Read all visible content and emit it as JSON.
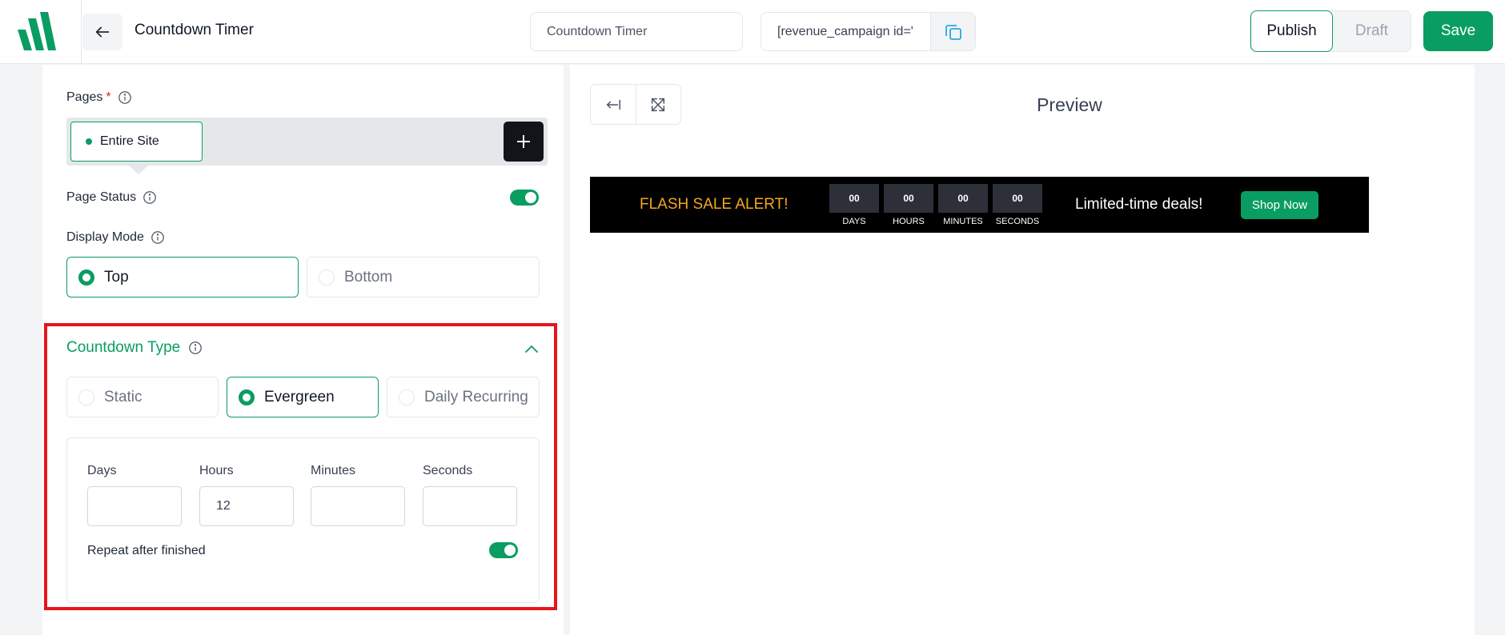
{
  "colors": {
    "brand_green": "#0a9d61",
    "highlight_red": "#e8141b",
    "banner_headline": "#f5a623"
  },
  "header": {
    "page_title": "Countdown Timer",
    "title_input_value": "Countdown Timer",
    "shortcode_value": "[revenue_campaign id='",
    "publish_label": "Publish",
    "draft_label": "Draft",
    "save_label": "Save",
    "icons": {
      "logo": "brand-logo",
      "back": "arrow-left-icon",
      "copy": "copy-icon"
    }
  },
  "settings": {
    "pages": {
      "label": "Pages",
      "required_mark": "*",
      "selected_chip": "Entire Site"
    },
    "page_status": {
      "label": "Page Status",
      "enabled": true
    },
    "display_mode": {
      "label": "Display Mode",
      "options": [
        "Top",
        "Bottom"
      ],
      "selected": "Top"
    },
    "countdown_type": {
      "title": "Countdown Type",
      "options": [
        "Static",
        "Evergreen",
        "Daily Recurring"
      ],
      "selected": "Evergreen",
      "fields": {
        "days_label": "Days",
        "hours_label": "Hours",
        "minutes_label": "Minutes",
        "seconds_label": "Seconds",
        "days_value": "",
        "hours_value": "12",
        "minutes_value": "",
        "seconds_value": ""
      },
      "repeat_label": "Repeat after finished",
      "repeat_enabled": true
    }
  },
  "preview": {
    "title": "Preview",
    "banner": {
      "headline": "FLASH SALE ALERT!",
      "countdown": [
        {
          "value": "00",
          "unit": "DAYS"
        },
        {
          "value": "00",
          "unit": "HOURS"
        },
        {
          "value": "00",
          "unit": "MINUTES"
        },
        {
          "value": "00",
          "unit": "SECONDS"
        }
      ],
      "subtext": "Limited-time deals!",
      "button_label": "Shop Now"
    }
  }
}
